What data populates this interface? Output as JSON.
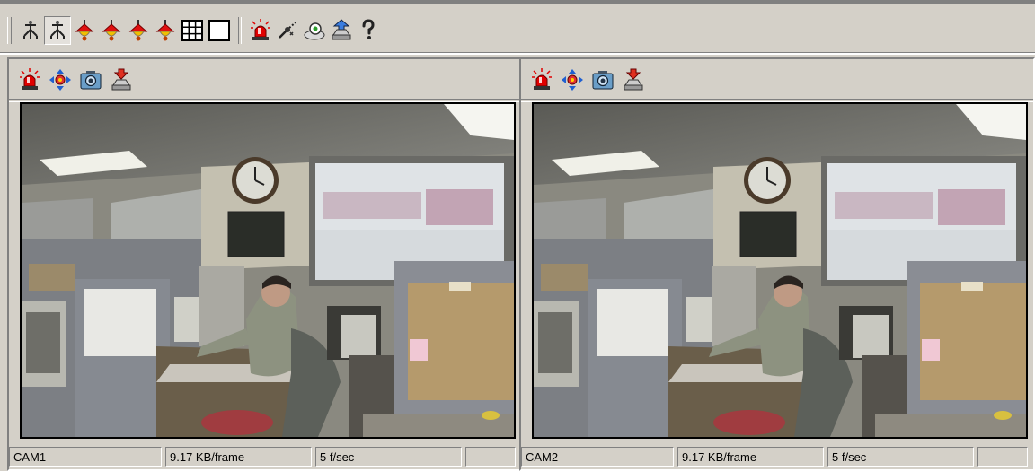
{
  "toolbar": {
    "icons": [
      "single-view-icon",
      "quad-view-pressed-icon",
      "alarm-bell-1-icon",
      "alarm-bell-2-icon",
      "alarm-bell-3-icon",
      "alarm-bell-4-icon",
      "grid-layout-icon",
      "single-frame-icon",
      "alarm-siren-icon",
      "connect-icon",
      "snapshot-save-icon",
      "upload-icon",
      "help-icon"
    ],
    "colors": {
      "bell_red": "#e01010",
      "bell_yellow": "#f0c000",
      "siren_red": "#e00000",
      "upload_blue": "#3a7de0"
    }
  },
  "panes": [
    {
      "name": "CAM1",
      "frame_size": "9.17 KB/frame",
      "frame_rate": "5 f/sec",
      "extra": "",
      "tools": [
        "alarm-siren-icon",
        "ptz-move-icon",
        "camera-settings-icon",
        "record-download-icon"
      ]
    },
    {
      "name": "CAM2",
      "frame_size": "9.17 KB/frame",
      "frame_rate": "5 f/sec",
      "extra": "",
      "tools": [
        "alarm-siren-icon",
        "ptz-move-icon",
        "camera-settings-icon",
        "record-download-icon"
      ]
    }
  ],
  "feed": {
    "scene": "office-camera-feed",
    "tint": "#3b3a35"
  }
}
